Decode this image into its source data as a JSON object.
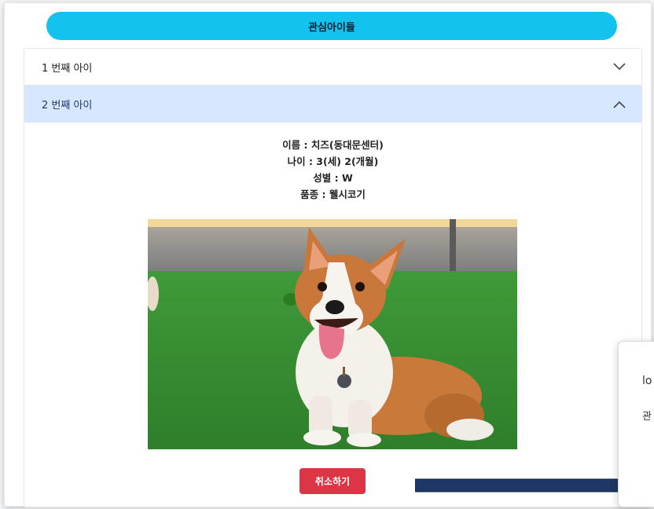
{
  "header": {
    "title": "관심아이들"
  },
  "accordion": {
    "items": [
      {
        "label": "1 번째 아이",
        "expanded": false
      },
      {
        "label": "2 번째 아이",
        "expanded": true
      }
    ]
  },
  "pet": {
    "name_line": "이름 : 치즈(동대문센터)",
    "age_line": "나이 : 3(세) 2(개월)",
    "gender_line": "성별 : W",
    "breed_line": "품종 : 웰시코기",
    "photo_subject": "corgi-photo"
  },
  "actions": {
    "cancel_label": "취소하기"
  },
  "popup": {
    "line1": "lo",
    "line2": "관"
  },
  "colors": {
    "header_pill": "#13c3ee",
    "open_item_bg": "#d6e7ff",
    "cancel_button": "#dc3545",
    "annotation_arrow": "#1e3764"
  }
}
